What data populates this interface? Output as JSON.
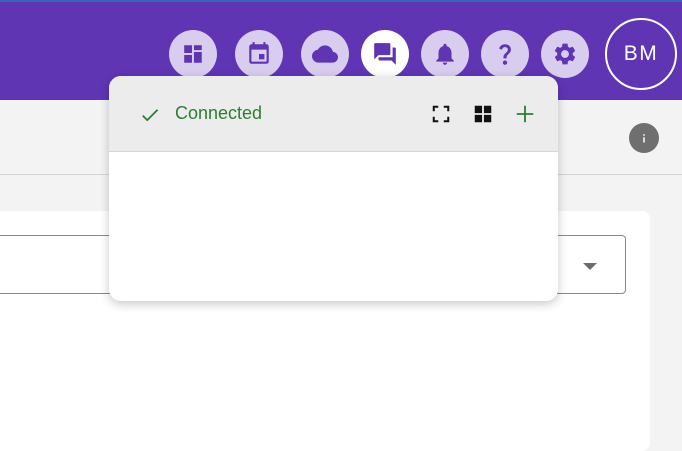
{
  "header": {
    "avatar_initials": "BM",
    "buttons": [
      {
        "icon": "dashboard-icon",
        "active": false
      },
      {
        "icon": "calendar-icon",
        "active": false
      },
      {
        "icon": "cloud-icon",
        "active": false
      },
      {
        "icon": "chat-icon",
        "active": true
      },
      {
        "icon": "bell-icon",
        "active": false
      },
      {
        "icon": "help-icon",
        "active": false
      },
      {
        "icon": "gear-icon",
        "active": false
      }
    ]
  },
  "toolbar": {
    "info_icon": "info-icon"
  },
  "chat_popover": {
    "status": "Connected",
    "status_icon": "check-icon",
    "tools": [
      "fullscreen-icon",
      "grid-icon",
      "plus-icon"
    ]
  },
  "main": {
    "select": {
      "value": "",
      "arrow_icon": "dropdown-arrow-icon"
    }
  },
  "colors": {
    "header_bg": "#5f35b4",
    "header_button_bg": "#d9cdef",
    "connected_green": "#2e7d32",
    "page_bg": "#f3f3f3"
  }
}
